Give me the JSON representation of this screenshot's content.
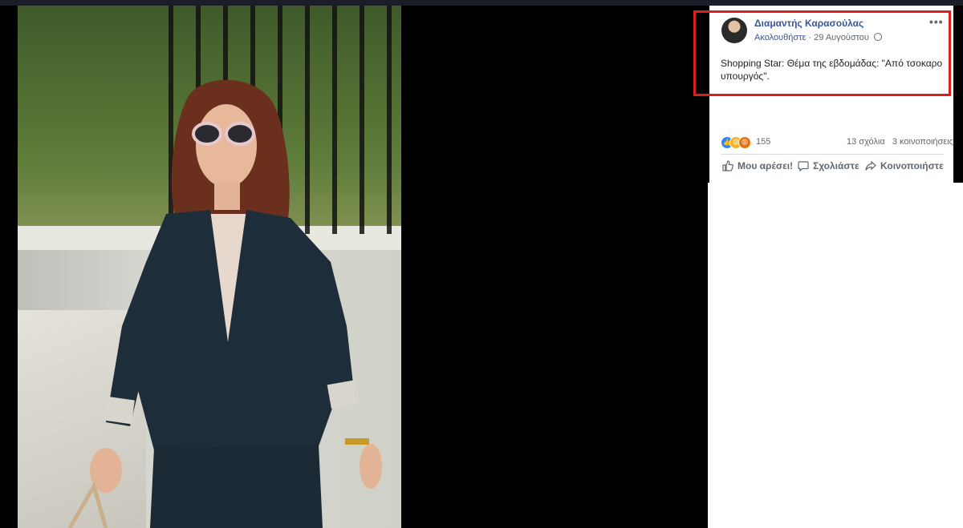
{
  "post": {
    "author": "Διαμαντής Καρασούλας",
    "follow_label": "Ακολουθήστε",
    "separator": "·",
    "date": "29 Αυγούστου",
    "more_label": "•••",
    "caption": "Shopping Star: Θέμα της εβδομάδας: \"Από τσοκαρο υπουργός\"."
  },
  "engagement": {
    "reaction_count": "155",
    "comments": "13 σχόλια",
    "shares": "3 κοινοποιήσεις",
    "reactions": [
      "like-icon",
      "haha-icon",
      "angry-icon"
    ]
  },
  "actions": {
    "like_label": "Μου αρέσει!",
    "comment_label": "Σχολιάστε",
    "share_label": "Κοινοποιήστε"
  },
  "colors": {
    "link": "#385898",
    "highlight_border": "#d62020"
  }
}
